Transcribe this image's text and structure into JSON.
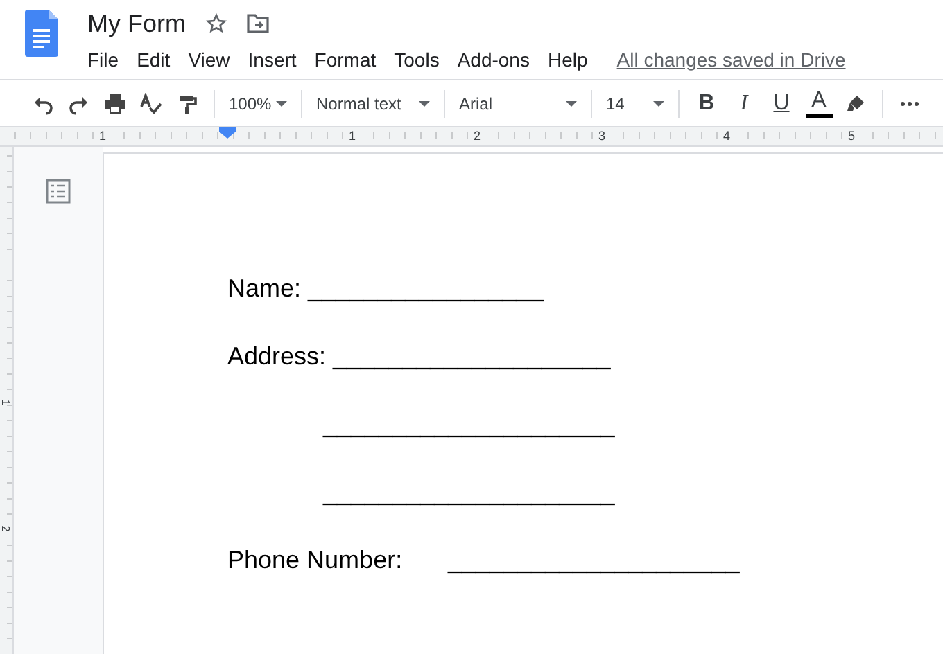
{
  "app": {
    "title": "My Form",
    "menu": [
      "File",
      "Edit",
      "View",
      "Insert",
      "Format",
      "Tools",
      "Add-ons",
      "Help"
    ],
    "save_status": "All changes saved in Drive"
  },
  "toolbar": {
    "zoom": "100%",
    "style": "Normal text",
    "font": "Arial",
    "size": "14",
    "format_buttons": [
      "B",
      "I",
      "U",
      "A"
    ]
  },
  "ruler": {
    "marks": [
      "1",
      "1",
      "2",
      "3",
      "4",
      "5"
    ]
  },
  "vertical_ruler": {
    "marks": [
      "1",
      "2"
    ]
  },
  "document": {
    "lines": [
      {
        "kind": "field",
        "label": "Name:",
        "blank": "_________________"
      },
      {
        "kind": "field",
        "label": "Address:",
        "blank": "____________________"
      },
      {
        "kind": "continuation",
        "blank": "_____________________"
      },
      {
        "kind": "continuation",
        "blank": "_____________________"
      },
      {
        "kind": "tabbed",
        "label": "Phone Number:",
        "blank": "_____________________"
      }
    ]
  }
}
